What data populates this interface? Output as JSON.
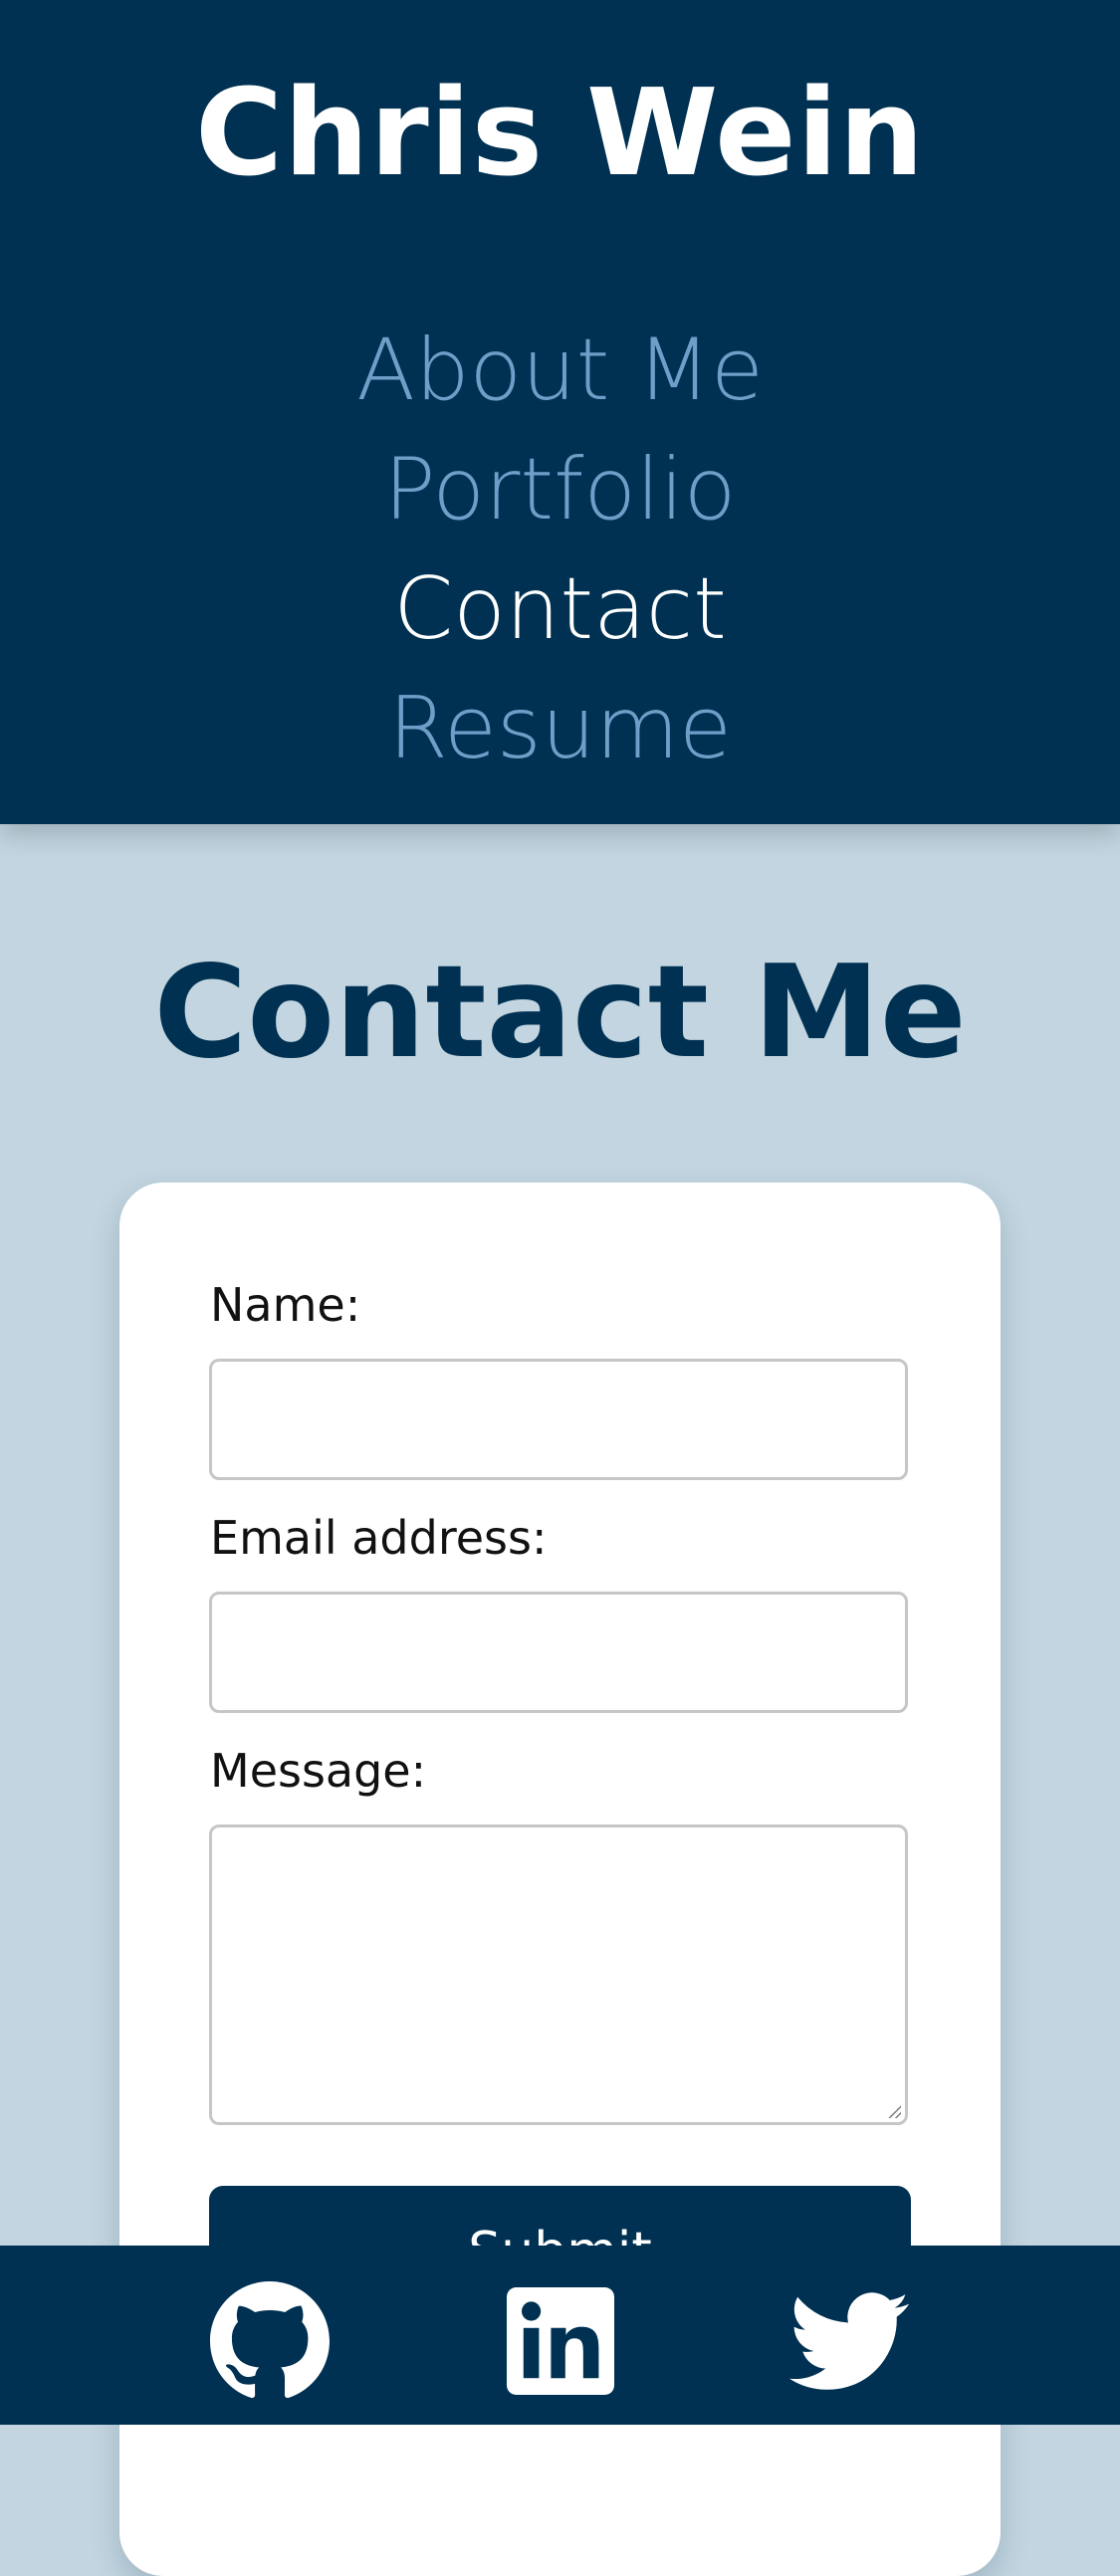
{
  "header": {
    "site_title": "Chris Wein",
    "nav": [
      {
        "label": "About Me",
        "active": false
      },
      {
        "label": "Portfolio",
        "active": false
      },
      {
        "label": "Contact",
        "active": true
      },
      {
        "label": "Resume",
        "active": false
      }
    ]
  },
  "main": {
    "heading": "Contact Me",
    "form": {
      "name_label": "Name:",
      "name_value": "",
      "email_label": "Email address:",
      "email_value": "",
      "message_label": "Message:",
      "message_value": "",
      "submit_label": "Submit"
    }
  },
  "footer": {
    "social": [
      {
        "name": "GitHub",
        "icon": "github-icon"
      },
      {
        "name": "LinkedIn",
        "icon": "linkedin-icon"
      },
      {
        "name": "Twitter",
        "icon": "twitter-icon"
      }
    ]
  },
  "colors": {
    "primary": "#003152",
    "background": "#c2d5e0",
    "nav_inactive": "#6f9fc9",
    "nav_active": "#ffffff"
  }
}
